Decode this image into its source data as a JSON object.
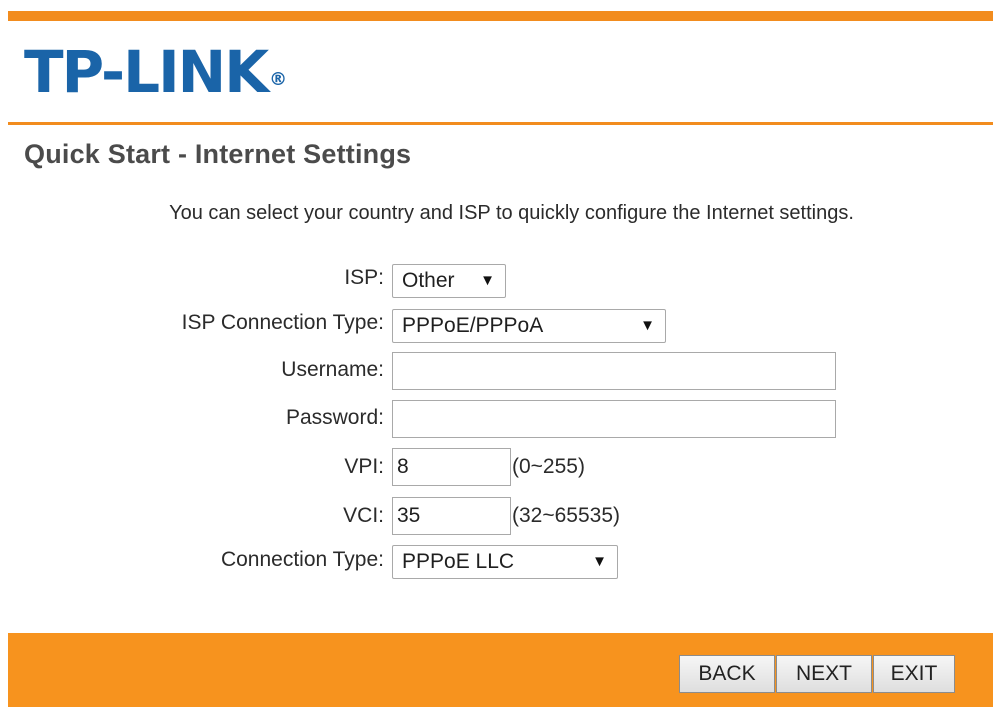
{
  "brand": {
    "logo_text": "TP-LINK",
    "registered_mark": "®",
    "accent_color": "#f28c1e",
    "logo_color": "#1a64a8"
  },
  "page": {
    "title": "Quick Start - Internet Settings",
    "intro": "You can select your country and ISP to quickly configure the Internet settings."
  },
  "form": {
    "isp": {
      "label": "ISP:",
      "value": "Other"
    },
    "isp_connection_type": {
      "label": "ISP Connection Type:",
      "value": "PPPoE/PPPoA"
    },
    "username": {
      "label": "Username:",
      "value": ""
    },
    "password": {
      "label": "Password:",
      "value": ""
    },
    "vpi": {
      "label": "VPI:",
      "value": "8",
      "range": "(0~255)"
    },
    "vci": {
      "label": "VCI:",
      "value": "35",
      "range": "(32~65535)"
    },
    "connection_type": {
      "label": "Connection Type:",
      "value": "PPPoE LLC"
    },
    "dropdown_arrow": "▼"
  },
  "buttons": {
    "back": "BACK",
    "next": "NEXT",
    "exit": "EXIT"
  }
}
